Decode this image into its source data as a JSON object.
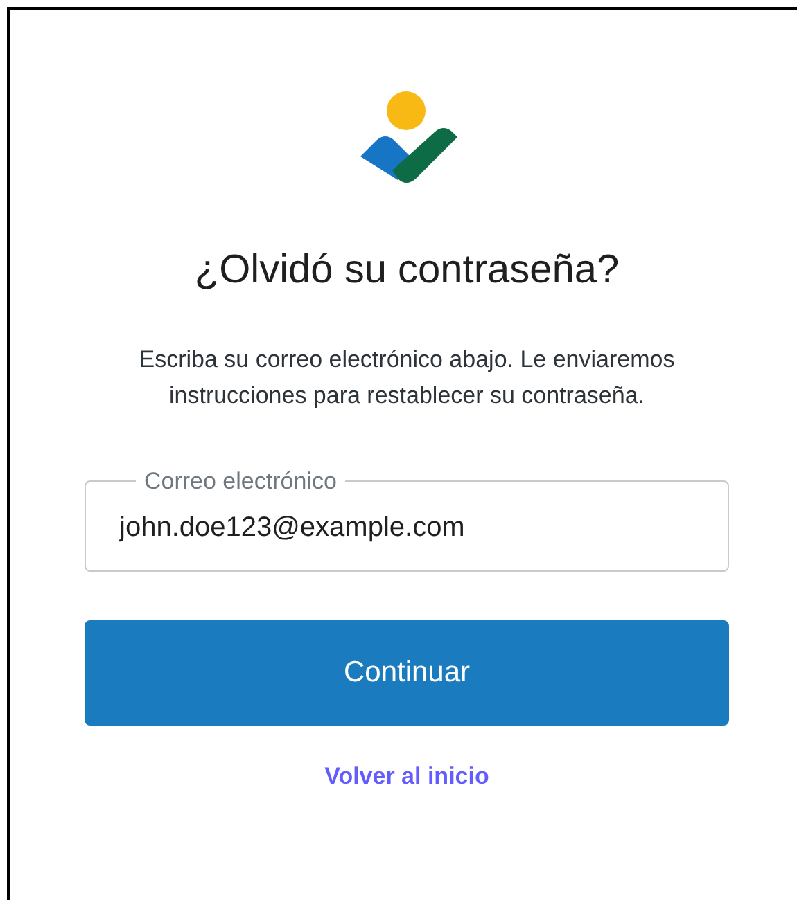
{
  "title": "¿Olvidó su contraseña?",
  "description": "Escriba su correo electrónico abajo. Le enviaremos instrucciones para restablecer su contraseña.",
  "email_field": {
    "label": "Correo electrónico",
    "value": "john.doe123@example.com"
  },
  "primary_button": "Continuar",
  "link": "Volver al inicio"
}
